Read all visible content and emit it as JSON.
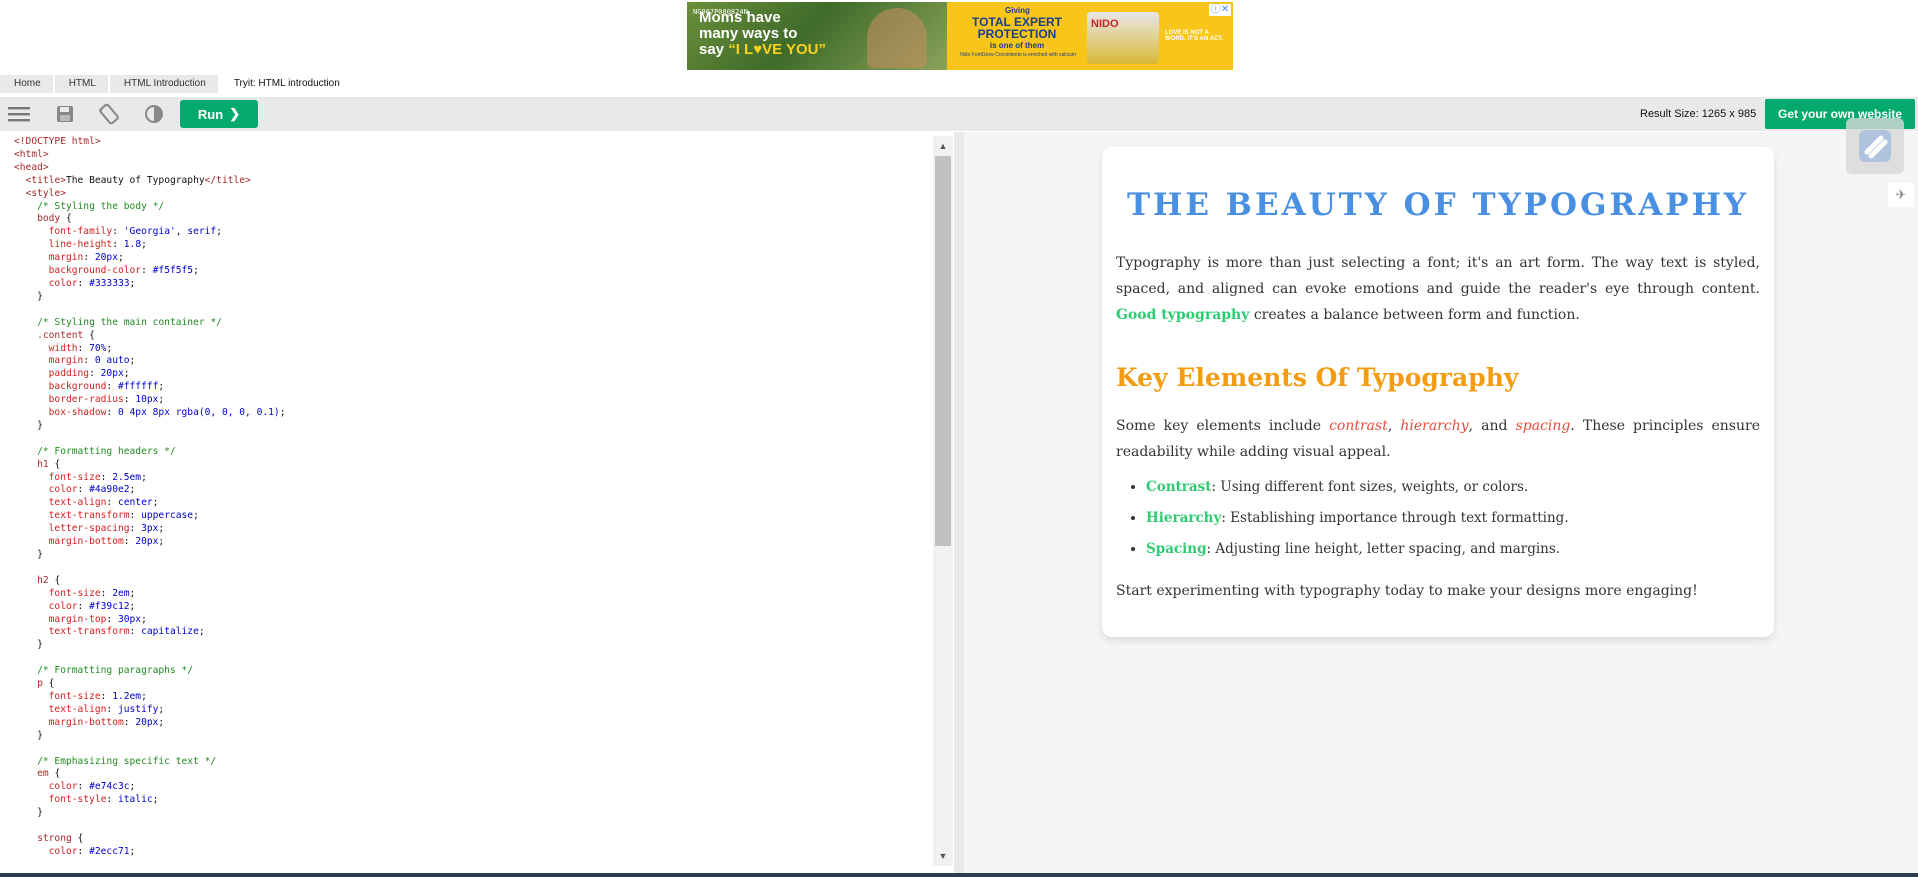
{
  "ad": {
    "headline_1": "Moms have",
    "headline_2": "many ways to",
    "headline_3_prefix": "say ",
    "headline_3_love": "“I L♥VE YOU”",
    "code": "NG007P080824N",
    "giving": "Giving",
    "tep_1": "TOTAL EXPERT",
    "tep_2": "PROTECTION",
    "one_of": "is one of them",
    "fine_print": "Nido FortiGrow Crecimiento is enriched with calcium",
    "brand": "NIDO",
    "slogan": "LOVE IS NOT A WORD. IT'S AN ACT.",
    "close": "ⓘ✕"
  },
  "breadcrumb": [
    "Home",
    "HTML",
    "HTML Introduction"
  ],
  "breadcrumb_current": "Tryit: HTML introduction",
  "toolbar": {
    "run_label": "Run",
    "result_size": "Result Size: 1265 x 985",
    "own_site_label": "Get your own website"
  },
  "code_lines": [
    [
      [
        "c-tag",
        "<!DOCTYPE html>"
      ]
    ],
    [
      [
        "c-tag",
        "<html>"
      ]
    ],
    [
      [
        "c-tag",
        "<head>"
      ]
    ],
    [
      [
        "c-bl",
        "  "
      ],
      [
        "c-tag",
        "<title>"
      ],
      [
        "c-bl",
        "The Beauty of Typography"
      ],
      [
        "c-tag",
        "</title>"
      ]
    ],
    [
      [
        "c-bl",
        "  "
      ],
      [
        "c-tag",
        "<style>"
      ]
    ],
    [
      [
        "c-cm",
        "    /* Styling the body */"
      ]
    ],
    [
      [
        "c-sel",
        "    body "
      ],
      [
        "c-bl",
        "{"
      ]
    ],
    [
      [
        "c-prop",
        "      font-family"
      ],
      [
        "c-bl",
        ": "
      ],
      [
        "c-val",
        "'Georgia'"
      ],
      [
        "c-bl",
        ", "
      ],
      [
        "c-val",
        "serif"
      ],
      [
        "c-bl",
        ";"
      ]
    ],
    [
      [
        "c-prop",
        "      line-height"
      ],
      [
        "c-bl",
        ": "
      ],
      [
        "c-val",
        "1.8"
      ],
      [
        "c-bl",
        ";"
      ]
    ],
    [
      [
        "c-prop",
        "      margin"
      ],
      [
        "c-bl",
        ": "
      ],
      [
        "c-val",
        "20px"
      ],
      [
        "c-bl",
        ";"
      ]
    ],
    [
      [
        "c-prop",
        "      background-color"
      ],
      [
        "c-bl",
        ": "
      ],
      [
        "c-val",
        "#f5f5f5"
      ],
      [
        "c-bl",
        ";"
      ]
    ],
    [
      [
        "c-prop",
        "      color"
      ],
      [
        "c-bl",
        ": "
      ],
      [
        "c-val",
        "#333333"
      ],
      [
        "c-bl",
        ";"
      ]
    ],
    [
      [
        "c-bl",
        "    }"
      ]
    ],
    [
      [
        "c-bl",
        ""
      ]
    ],
    [
      [
        "c-cm",
        "    /* Styling the main container */"
      ]
    ],
    [
      [
        "c-sel",
        "    .content "
      ],
      [
        "c-bl",
        "{"
      ]
    ],
    [
      [
        "c-prop",
        "      width"
      ],
      [
        "c-bl",
        ": "
      ],
      [
        "c-val",
        "70%"
      ],
      [
        "c-bl",
        ";"
      ]
    ],
    [
      [
        "c-prop",
        "      margin"
      ],
      [
        "c-bl",
        ": "
      ],
      [
        "c-val",
        "0 auto"
      ],
      [
        "c-bl",
        ";"
      ]
    ],
    [
      [
        "c-prop",
        "      padding"
      ],
      [
        "c-bl",
        ": "
      ],
      [
        "c-val",
        "20px"
      ],
      [
        "c-bl",
        ";"
      ]
    ],
    [
      [
        "c-prop",
        "      background"
      ],
      [
        "c-bl",
        ": "
      ],
      [
        "c-val",
        "#ffffff"
      ],
      [
        "c-bl",
        ";"
      ]
    ],
    [
      [
        "c-prop",
        "      border-radius"
      ],
      [
        "c-bl",
        ": "
      ],
      [
        "c-val",
        "10px"
      ],
      [
        "c-bl",
        ";"
      ]
    ],
    [
      [
        "c-prop",
        "      box-shadow"
      ],
      [
        "c-bl",
        ": "
      ],
      [
        "c-val",
        "0 4px 8px rgba(0, 0, 0, 0.1)"
      ],
      [
        "c-bl",
        ";"
      ]
    ],
    [
      [
        "c-bl",
        "    }"
      ]
    ],
    [
      [
        "c-bl",
        ""
      ]
    ],
    [
      [
        "c-cm",
        "    /* Formatting headers */"
      ]
    ],
    [
      [
        "c-sel",
        "    h1 "
      ],
      [
        "c-bl",
        "{"
      ]
    ],
    [
      [
        "c-prop",
        "      font-size"
      ],
      [
        "c-bl",
        ": "
      ],
      [
        "c-val",
        "2.5em"
      ],
      [
        "c-bl",
        ";"
      ]
    ],
    [
      [
        "c-prop",
        "      color"
      ],
      [
        "c-bl",
        ": "
      ],
      [
        "c-val",
        "#4a90e2"
      ],
      [
        "c-bl",
        ";"
      ]
    ],
    [
      [
        "c-prop",
        "      text-align"
      ],
      [
        "c-bl",
        ": "
      ],
      [
        "c-val",
        "center"
      ],
      [
        "c-bl",
        ";"
      ]
    ],
    [
      [
        "c-prop",
        "      text-transform"
      ],
      [
        "c-bl",
        ": "
      ],
      [
        "c-val",
        "uppercase"
      ],
      [
        "c-bl",
        ";"
      ]
    ],
    [
      [
        "c-prop",
        "      letter-spacing"
      ],
      [
        "c-bl",
        ": "
      ],
      [
        "c-val",
        "3px"
      ],
      [
        "c-bl",
        ";"
      ]
    ],
    [
      [
        "c-prop",
        "      margin-bottom"
      ],
      [
        "c-bl",
        ": "
      ],
      [
        "c-val",
        "20px"
      ],
      [
        "c-bl",
        ";"
      ]
    ],
    [
      [
        "c-bl",
        "    }"
      ]
    ],
    [
      [
        "c-bl",
        ""
      ]
    ],
    [
      [
        "c-sel",
        "    h2 "
      ],
      [
        "c-bl",
        "{"
      ]
    ],
    [
      [
        "c-prop",
        "      font-size"
      ],
      [
        "c-bl",
        ": "
      ],
      [
        "c-val",
        "2em"
      ],
      [
        "c-bl",
        ";"
      ]
    ],
    [
      [
        "c-prop",
        "      color"
      ],
      [
        "c-bl",
        ": "
      ],
      [
        "c-val",
        "#f39c12"
      ],
      [
        "c-bl",
        ";"
      ]
    ],
    [
      [
        "c-prop",
        "      margin-top"
      ],
      [
        "c-bl",
        ": "
      ],
      [
        "c-val",
        "30px"
      ],
      [
        "c-bl",
        ";"
      ]
    ],
    [
      [
        "c-prop",
        "      text-transform"
      ],
      [
        "c-bl",
        ": "
      ],
      [
        "c-val",
        "capitalize"
      ],
      [
        "c-bl",
        ";"
      ]
    ],
    [
      [
        "c-bl",
        "    }"
      ]
    ],
    [
      [
        "c-bl",
        ""
      ]
    ],
    [
      [
        "c-cm",
        "    /* Formatting paragraphs */"
      ]
    ],
    [
      [
        "c-sel",
        "    p "
      ],
      [
        "c-bl",
        "{"
      ]
    ],
    [
      [
        "c-prop",
        "      font-size"
      ],
      [
        "c-bl",
        ": "
      ],
      [
        "c-val",
        "1.2em"
      ],
      [
        "c-bl",
        ";"
      ]
    ],
    [
      [
        "c-prop",
        "      text-align"
      ],
      [
        "c-bl",
        ": "
      ],
      [
        "c-val",
        "justify"
      ],
      [
        "c-bl",
        ";"
      ]
    ],
    [
      [
        "c-prop",
        "      margin-bottom"
      ],
      [
        "c-bl",
        ": "
      ],
      [
        "c-val",
        "20px"
      ],
      [
        "c-bl",
        ";"
      ]
    ],
    [
      [
        "c-bl",
        "    }"
      ]
    ],
    [
      [
        "c-bl",
        ""
      ]
    ],
    [
      [
        "c-cm",
        "    /* Emphasizing specific text */"
      ]
    ],
    [
      [
        "c-sel",
        "    em "
      ],
      [
        "c-bl",
        "{"
      ]
    ],
    [
      [
        "c-prop",
        "      color"
      ],
      [
        "c-bl",
        ": "
      ],
      [
        "c-val",
        "#e74c3c"
      ],
      [
        "c-bl",
        ";"
      ]
    ],
    [
      [
        "c-prop",
        "      font-style"
      ],
      [
        "c-bl",
        ": "
      ],
      [
        "c-val",
        "italic"
      ],
      [
        "c-bl",
        ";"
      ]
    ],
    [
      [
        "c-bl",
        "    }"
      ]
    ],
    [
      [
        "c-bl",
        ""
      ]
    ],
    [
      [
        "c-sel",
        "    strong "
      ],
      [
        "c-bl",
        "{"
      ]
    ],
    [
      [
        "c-prop",
        "      color"
      ],
      [
        "c-bl",
        ": "
      ],
      [
        "c-val",
        "#2ecc71"
      ],
      [
        "c-bl",
        ";"
      ]
    ]
  ],
  "result": {
    "h1": "The Beauty of Typography",
    "p1_a": "Typography is more than just selecting a font; it's an art form. The way text is styled, spaced, and aligned can evoke emotions and guide the reader's eye through content. ",
    "p1_strong": "Good typography",
    "p1_b": " creates a balance between form and function.",
    "h2": "Key Elements Of Typography",
    "p2_a": "Some key elements include ",
    "p2_em1": "contrast",
    "p2_sep1": ", ",
    "p2_em2": "hierarchy",
    "p2_sep2": ", and ",
    "p2_em3": "spacing",
    "p2_b": ". These principles ensure readability while adding visual appeal.",
    "items": [
      {
        "term": "Contrast",
        "desc": ": Using different font sizes, weights, or colors."
      },
      {
        "term": "Hierarchy",
        "desc": ": Establishing importance through text formatting."
      },
      {
        "term": "Spacing",
        "desc": ": Adjusting line height, letter spacing, and margins."
      }
    ],
    "p3": "Start experimenting with typography today to make your designs more engaging!"
  },
  "icons": {
    "menu": "menu-icon",
    "save": "save-icon",
    "rotate": "rotate-icon",
    "contrast": "contrast-icon",
    "chevron": "❯",
    "rocket": "✈"
  },
  "colors": {
    "accent_green": "#04aa6d",
    "h1": "#4a90e2",
    "h2": "#f39c12",
    "strong": "#2ecc71",
    "em": "#e74c3c"
  }
}
